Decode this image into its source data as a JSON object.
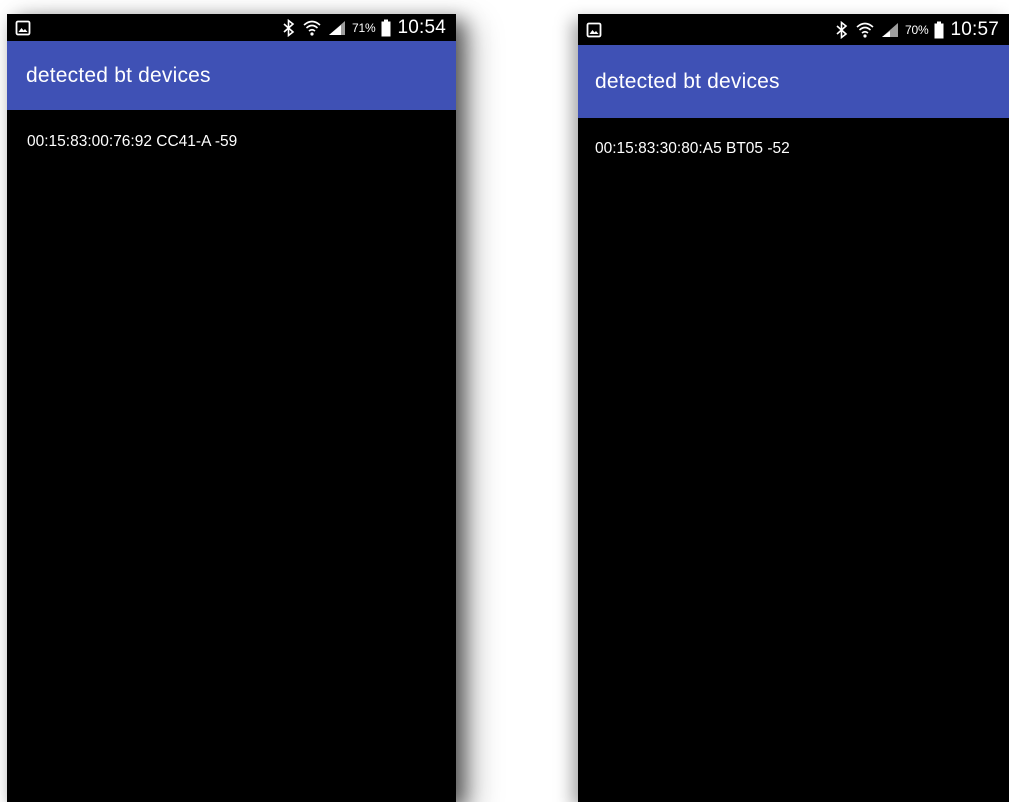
{
  "screens": [
    {
      "status_bar": {
        "notification_icon": "gallery-notification-icon",
        "bluetooth_icon": "bluetooth-icon",
        "wifi_icon": "wifi-icon",
        "signal_icon": "cell-signal-icon",
        "battery_percent": "71%",
        "battery_icon": "battery-icon",
        "time": "10:54"
      },
      "app_bar": {
        "title": "detected bt devices",
        "color": "#3f51b5"
      },
      "devices": [
        {
          "label": "00:15:83:00:76:92 CC41-A -59"
        }
      ]
    },
    {
      "status_bar": {
        "notification_icon": "gallery-notification-icon",
        "bluetooth_icon": "bluetooth-icon",
        "wifi_icon": "wifi-icon",
        "signal_icon": "cell-signal-icon",
        "battery_percent": "70%",
        "battery_icon": "battery-icon",
        "time": "10:57"
      },
      "app_bar": {
        "title": "detected bt devices",
        "color": "#3f51b5"
      },
      "devices": [
        {
          "label": "00:15:83:30:80:A5 BT05 -52"
        }
      ]
    }
  ]
}
